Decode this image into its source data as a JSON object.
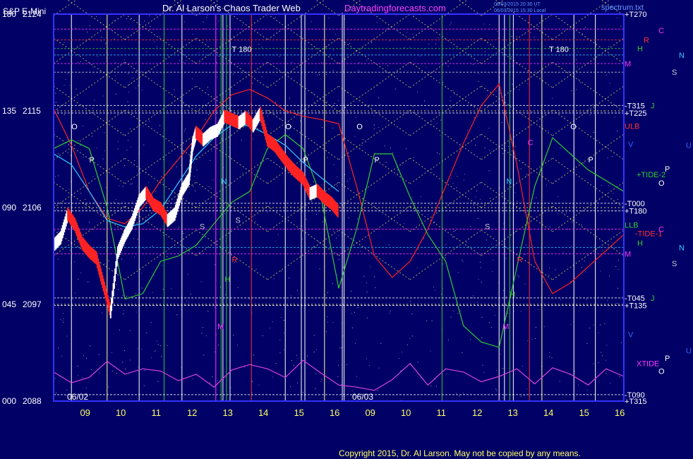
{
  "header": {
    "instrument": "S&P E-Mini",
    "title": "Dr. Al Larson's Chaos Trader Web",
    "site": "Daytradingforecasts.com",
    "stamp_line1": "06/03/2015 20:30 UT",
    "stamp_line2": "06/03/2015 15:30 Local",
    "spectrum_label": "spectrum.txt"
  },
  "footer": {
    "copyright": "Copyright 2015, Dr. Al Larson. May not be copied by any means."
  },
  "colors": {
    "background": "#000066",
    "plot_border": "#3333ff",
    "text_white": "#ffffff",
    "text_red": "#ff3333",
    "text_magenta": "#ff33ff",
    "text_green": "#33cc33",
    "text_cyan": "#33ccff",
    "text_yellow": "#ffff66",
    "text_blue": "#3366ff"
  },
  "chart_data": {
    "type": "line",
    "y_axis": {
      "degree_labels": [
        "180",
        "135",
        "090",
        "045",
        "000"
      ],
      "price_labels": [
        "2124",
        "2115",
        "2106",
        "2097",
        "2088"
      ],
      "price_ticks": [
        2124,
        2115,
        2106,
        2097,
        2088
      ],
      "ylim": [
        2088,
        2124
      ]
    },
    "x_axis": {
      "day1_label": "06/02",
      "day2_label": "06/03",
      "hour_labels": [
        "09",
        "10",
        "11",
        "12",
        "13",
        "14",
        "15",
        "16",
        "09",
        "10",
        "11",
        "12",
        "13",
        "14",
        "15",
        "16"
      ],
      "hour_positions": [
        8.9,
        9.9,
        10.9,
        11.9,
        12.9,
        13.9,
        14.9,
        15.9,
        16.9,
        17.9,
        18.9,
        19.9,
        20.9,
        21.9,
        22.9,
        23.9
      ],
      "xlim": [
        8.0,
        24.0
      ]
    },
    "right_labels": [
      {
        "text": "+T270",
        "color": "#ffffff",
        "value": 2124
      },
      {
        "text": "C",
        "color": "#ff33ff",
        "value": 2122.5
      },
      {
        "text": "R",
        "color": "#ff3333",
        "value": 2121.6
      },
      {
        "text": "H",
        "color": "#33cc33",
        "value": 2120.8
      },
      {
        "text": "N",
        "color": "#33ccff",
        "value": 2120.2
      },
      {
        "text": "M",
        "color": "#ff33ff",
        "value": 2119.4
      },
      {
        "text": "S",
        "color": "#cccccc",
        "value": 2118.6
      },
      {
        "text": "-T315",
        "color": "#ffffff",
        "value": 2115.5
      },
      {
        "text": "J",
        "color": "#33cc33",
        "value": 2115.5
      },
      {
        "text": "+T225",
        "color": "#ffffff",
        "value": 2114.8
      },
      {
        "text": "ULB",
        "color": "#ff3333",
        "value": 2113.6
      },
      {
        "text": "V",
        "color": "#3366ff",
        "value": 2111.9
      },
      {
        "text": "U",
        "color": "#3366ff",
        "value": 2111.8
      },
      {
        "text": "P",
        "color": "#ffffff",
        "value": 2109.6
      },
      {
        "text": "+TIDE-2",
        "color": "#33cc33",
        "value": 2109.1
      },
      {
        "text": "O",
        "color": "#ffffff",
        "value": 2108.3
      },
      {
        "text": "-T000",
        "color": "#ffffff",
        "value": 2106.4
      },
      {
        "text": "+T180",
        "color": "#ffffff",
        "value": 2105.7
      },
      {
        "text": "LLB",
        "color": "#33cc33",
        "value": 2104.4
      },
      {
        "text": "C",
        "color": "#ff33ff",
        "value": 2104.0
      },
      {
        "text": "-TIDE-1",
        "color": "#ff3333",
        "value": 2103.6
      },
      {
        "text": "H",
        "color": "#33cc33",
        "value": 2102.7
      },
      {
        "text": "N",
        "color": "#33ccff",
        "value": 2102.3
      },
      {
        "text": "M",
        "color": "#ff33ff",
        "value": 2101.7
      },
      {
        "text": "S",
        "color": "#cccccc",
        "value": 2100.8
      },
      {
        "text": "-T045",
        "color": "#ffffff",
        "value": 2097.6
      },
      {
        "text": "J",
        "color": "#33cc33",
        "value": 2097.6
      },
      {
        "text": "+T135",
        "color": "#ffffff",
        "value": 2096.9
      },
      {
        "text": "V",
        "color": "#3366ff",
        "value": 2094.2
      },
      {
        "text": "U",
        "color": "#3366ff",
        "value": 2092.7
      },
      {
        "text": "P",
        "color": "#ffffff",
        "value": 2092.0
      },
      {
        "text": "XTIDE",
        "color": "#ff33ff",
        "value": 2091.5
      },
      {
        "text": "O",
        "color": "#ffffff",
        "value": 2090.8
      },
      {
        "text": "-T090",
        "color": "#ffffff",
        "value": 2088.6
      },
      {
        "text": "+T315",
        "color": "#ffffff",
        "value": 2088.0
      }
    ],
    "plot_markers": [
      {
        "text": "O",
        "color": "#ffffff",
        "x": 8.5,
        "y": 2113.3
      },
      {
        "text": "P",
        "color": "#ffffff",
        "x": 9.0,
        "y": 2110.2
      },
      {
        "text": "N",
        "color": "#33ccff",
        "x": 12.7,
        "y": 2108.2
      },
      {
        "text": "S",
        "color": "#cccccc",
        "x": 12.1,
        "y": 2104.0
      },
      {
        "text": "S",
        "color": "#cccccc",
        "x": 13.1,
        "y": 2104.6
      },
      {
        "text": "R",
        "color": "#ff3333",
        "x": 13.0,
        "y": 2100.9
      },
      {
        "text": "H",
        "color": "#33cc33",
        "x": 12.8,
        "y": 2099.1
      },
      {
        "text": "M",
        "color": "#ff33ff",
        "x": 12.6,
        "y": 2094.7
      },
      {
        "text": "T 180",
        "color": "#ffffff",
        "x": 13.0,
        "y": 2120.5
      },
      {
        "text": "O",
        "color": "#ffffff",
        "x": 14.5,
        "y": 2113.3
      },
      {
        "text": "P",
        "color": "#ffffff",
        "x": 15.0,
        "y": 2110.2
      },
      {
        "text": "O",
        "color": "#ffffff",
        "x": 16.5,
        "y": 2113.3
      },
      {
        "text": "P",
        "color": "#ffffff",
        "x": 17.0,
        "y": 2110.2
      },
      {
        "text": "S",
        "color": "#cccccc",
        "x": 20.1,
        "y": 2104.0
      },
      {
        "text": "N",
        "color": "#33ccff",
        "x": 20.7,
        "y": 2108.2
      },
      {
        "text": "H",
        "color": "#33cc33",
        "x": 20.8,
        "y": 2097.7
      },
      {
        "text": "M",
        "color": "#ff33ff",
        "x": 20.6,
        "y": 2094.7
      },
      {
        "text": "R",
        "color": "#ff3333",
        "x": 21.0,
        "y": 2100.9
      },
      {
        "text": "C",
        "color": "#ff33ff",
        "x": 21.3,
        "y": 2111.8
      },
      {
        "text": "T 180",
        "color": "#ffffff",
        "x": 21.9,
        "y": 2120.5
      },
      {
        "text": "O",
        "color": "#ffffff",
        "x": 22.5,
        "y": 2113.3
      },
      {
        "text": "P",
        "color": "#ffffff",
        "x": 23.0,
        "y": 2110.2
      }
    ],
    "vertical_lines": [
      {
        "x": 8.5,
        "color": "#ffffff"
      },
      {
        "x": 9.5,
        "color": "#ffff99"
      },
      {
        "x": 10.4,
        "color": "#ffffff"
      },
      {
        "x": 11.1,
        "color": "#33cc33"
      },
      {
        "x": 11.6,
        "color": "#ffffff"
      },
      {
        "x": 12.55,
        "color": "#ff33ff"
      },
      {
        "x": 12.7,
        "color": "#33cc33"
      },
      {
        "x": 12.75,
        "color": "#ffffff"
      },
      {
        "x": 12.85,
        "color": "#33cc33"
      },
      {
        "x": 12.95,
        "color": "#ffffff"
      },
      {
        "x": 13.55,
        "color": "#ff3333"
      },
      {
        "x": 14.5,
        "color": "#ffffff"
      },
      {
        "x": 14.95,
        "color": "#ffffff"
      },
      {
        "x": 15.05,
        "color": "#ffffff"
      },
      {
        "x": 15.6,
        "color": "#ffff99"
      },
      {
        "x": 16.1,
        "color": "#ffffff"
      },
      {
        "x": 16.15,
        "color": "#ffffff"
      },
      {
        "x": 18.9,
        "color": "#33cc33"
      },
      {
        "x": 20.5,
        "color": "#ffffff"
      },
      {
        "x": 20.65,
        "color": "#ffffff"
      },
      {
        "x": 20.8,
        "color": "#33cc33"
      },
      {
        "x": 20.9,
        "color": "#ffffff"
      },
      {
        "x": 21.35,
        "color": "#ff3333"
      },
      {
        "x": 21.7,
        "color": "#ffff99"
      },
      {
        "x": 22.6,
        "color": "#ffffff"
      },
      {
        "x": 23.2,
        "color": "#ffffff"
      }
    ],
    "horizontal_lines": [
      {
        "y": 2124,
        "color": "#ffffff"
      },
      {
        "y": 2122.6,
        "color": "#ff33ff"
      },
      {
        "y": 2121.6,
        "color": "#ff3333"
      },
      {
        "y": 2120.8,
        "color": "#33cc33"
      },
      {
        "y": 2120.2,
        "color": "#33ccff"
      },
      {
        "y": 2119.4,
        "color": "#ff33ff"
      },
      {
        "y": 2118.6,
        "color": "#cccccc"
      },
      {
        "y": 2115.5,
        "color": "#ffffff"
      },
      {
        "y": 2114.8,
        "color": "#ffffff"
      },
      {
        "y": 2106.4,
        "color": "#ffffff"
      },
      {
        "y": 2105.7,
        "color": "#ffffff"
      },
      {
        "y": 2104.0,
        "color": "#ff33ff"
      },
      {
        "y": 2102.3,
        "color": "#33ccff"
      },
      {
        "y": 2101.7,
        "color": "#ff33ff"
      },
      {
        "y": 2097.6,
        "color": "#ffffff"
      },
      {
        "y": 2096.9,
        "color": "#ffffff"
      },
      {
        "y": 2088.6,
        "color": "#ffffff"
      }
    ],
    "price_series": {
      "name": "S&P E-Mini",
      "x": [
        8.0,
        8.2,
        8.4,
        8.6,
        8.8,
        9.0,
        9.2,
        9.4,
        9.6,
        9.8,
        10.0,
        10.2,
        10.4,
        10.6,
        10.8,
        11.0,
        11.2,
        11.4,
        11.6,
        11.8,
        11.9,
        12.0,
        12.2,
        12.4,
        12.6,
        12.8,
        13.0,
        13.2,
        13.4,
        13.6,
        13.8,
        14.0,
        14.2,
        14.4,
        14.6,
        14.8,
        15.0,
        15.2,
        15.4,
        15.6,
        15.8,
        16.0
      ],
      "y": [
        2102.5,
        2103.2,
        2105.4,
        2104.4,
        2102.7,
        2101.9,
        2101.3,
        2098.8,
        2096.3,
        2101.8,
        2103.4,
        2104.6,
        2106.6,
        2107.4,
        2106.3,
        2105.9,
        2104.8,
        2105.4,
        2107.6,
        2108.7,
        2111.8,
        2113.0,
        2112.3,
        2112.9,
        2113.2,
        2114.5,
        2114.2,
        2113.9,
        2114.4,
        2113.6,
        2114.8,
        2112.3,
        2111.8,
        2110.9,
        2110.0,
        2109.3,
        2108.7,
        2107.3,
        2107.6,
        2106.9,
        2106.4,
        2105.6
      ]
    },
    "forecast_lines": [
      {
        "name": "red",
        "color": "#ff2222",
        "x": [
          8.0,
          8.5,
          9.0,
          9.5,
          10.0,
          10.5,
          11.0,
          11.5,
          12.0,
          12.5,
          13.0,
          13.5,
          14.0,
          14.5,
          15.0,
          15.5,
          16.0,
          16.5,
          17.0,
          17.5,
          18.0,
          18.5,
          19.0,
          19.5,
          20.0,
          20.5,
          21.0,
          21.5,
          22.0,
          22.5,
          23.0,
          23.5,
          24.0
        ],
        "y": [
          2115.2,
          2111.8,
          2107.5,
          2105.0,
          2104.5,
          2106.0,
          2108.5,
          2110.5,
          2112.5,
          2115.0,
          2116.5,
          2117.0,
          2116.2,
          2115.0,
          2114.5,
          2114.2,
          2113.8,
          2108.0,
          2101.5,
          2099.5,
          2101.0,
          2104.0,
          2108.0,
          2112.0,
          2115.5,
          2117.5,
          2110.0,
          2101.0,
          2098.0,
          2099.0,
          2100.5,
          2102.0,
          2103.5
        ]
      },
      {
        "name": "green",
        "color": "#33cc33",
        "x": [
          8.0,
          8.5,
          9.0,
          9.5,
          10.0,
          10.5,
          11.0,
          11.5,
          12.0,
          12.5,
          13.0,
          13.5,
          14.0,
          14.5,
          15.0,
          15.5,
          16.0,
          16.5,
          17.0,
          17.5,
          18.0,
          18.5,
          19.0,
          19.5,
          20.0,
          20.5,
          21.0,
          21.5,
          22.0,
          22.5,
          23.0,
          23.5,
          24.0
        ],
        "y": [
          2111.5,
          2112.3,
          2111.5,
          2106.0,
          2097.5,
          2098.0,
          2101.0,
          2101.5,
          2102.5,
          2104.5,
          2106.5,
          2107.5,
          2111.5,
          2112.8,
          2111.5,
          2107.0,
          2098.5,
          2104.0,
          2111.0,
          2111.0,
          2107.0,
          2103.5,
          2101.0,
          2095.0,
          2093.5,
          2093.0,
          2100.5,
          2108.0,
          2112.5,
          2111.0,
          2109.5,
          2108.5,
          2107.5
        ]
      },
      {
        "name": "cyan",
        "color": "#33ccff",
        "x": [
          8.0,
          8.5,
          9.0,
          9.5,
          10.0,
          10.5,
          11.0,
          11.5,
          12.0,
          12.5,
          13.0,
          13.5,
          14.0,
          14.5,
          15.0,
          15.5,
          16.0
        ],
        "y": [
          2111.0,
          2110.0,
          2107.5,
          2104.8,
          2104.2,
          2104.5,
          2105.8,
          2108.3,
          2110.8,
          2112.5,
          2113.7,
          2113.6,
          2112.8,
          2111.8,
          2110.2,
          2108.8,
          2107.5
        ]
      },
      {
        "name": "magenta-xtide",
        "color": "#dd44dd",
        "x": [
          8.0,
          8.5,
          9.0,
          9.5,
          10.0,
          10.5,
          11.0,
          11.5,
          12.0,
          12.5,
          13.0,
          13.5,
          14.0,
          14.5,
          15.0,
          15.5,
          16.0,
          16.5,
          17.0,
          17.5,
          18.0,
          18.5,
          19.0,
          19.5,
          20.0,
          20.5,
          21.0,
          21.5,
          22.0,
          22.5,
          23.0,
          23.5,
          24.0
        ],
        "y": [
          2090.7,
          2089.7,
          2090.2,
          2091.7,
          2090.5,
          2091.0,
          2090.8,
          2089.9,
          2090.5,
          2089.3,
          2090.9,
          2091.4,
          2091.0,
          2090.2,
          2091.8,
          2090.6,
          2089.5,
          2089.3,
          2089.0,
          2090.0,
          2091.5,
          2089.5,
          2091.0,
          2090.7,
          2089.8,
          2090.3,
          2091.0,
          2089.6,
          2091.1,
          2090.5,
          2089.5,
          2091.0,
          2090.3
        ]
      }
    ]
  }
}
